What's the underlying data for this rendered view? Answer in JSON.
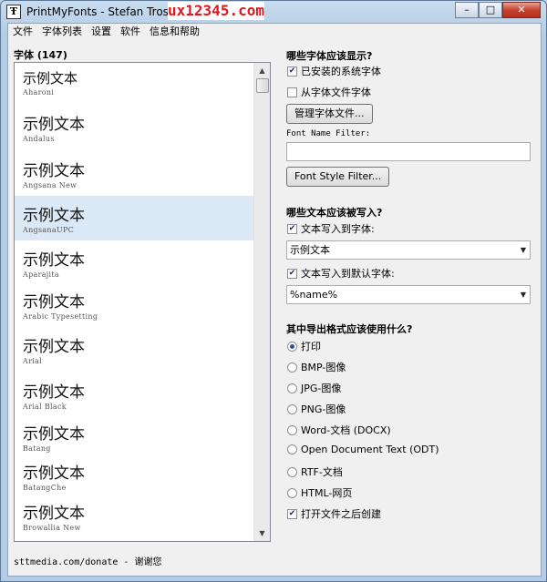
{
  "window": {
    "title": "PrintMyFonts - Stefan Trost Media",
    "watermark": "ux12345.com",
    "controls": {
      "minimize": "–",
      "maximize": "□",
      "close": "✕"
    }
  },
  "menu": [
    "文件",
    "字体列表",
    "设置",
    "软件",
    "信息和帮助"
  ],
  "font_list": {
    "heading": "字体 (147)",
    "items": [
      {
        "sample": "示例文本",
        "name": "Aharoni"
      },
      {
        "sample": "示例文本",
        "name": "Andalus"
      },
      {
        "sample": "示例文本",
        "name": "Angsana New"
      },
      {
        "sample": "示例文本",
        "name": "AngsanaUPC",
        "selected": true
      },
      {
        "sample": "示例文本",
        "name": "Aparajita"
      },
      {
        "sample": "示例文本",
        "name": "Arabic Typesetting"
      },
      {
        "sample": "示例文本",
        "name": "Arial"
      },
      {
        "sample": "示例文本",
        "name": "Arial Black"
      },
      {
        "sample": "示例文本",
        "name": "Batang"
      },
      {
        "sample": "示例文本",
        "name": "BatangChe"
      },
      {
        "sample": "示例文本",
        "name": "Browallia New"
      }
    ]
  },
  "display_section": {
    "heading": "哪些字体应该显示?",
    "installed_fonts": {
      "label": "已安装的系统字体",
      "checked": true
    },
    "from_files": {
      "label": "从字体文件字体",
      "checked": false
    },
    "manage_button": "管理字体文件...",
    "filter_label": "Font Name Filter:",
    "filter_value": "",
    "style_button": "Font Style Filter..."
  },
  "text_section": {
    "heading": "哪些文本应该被写入?",
    "write_text": {
      "label": "文本写入到字体:",
      "checked": true
    },
    "text_value": "示例文本",
    "write_default": {
      "label": "文本写入到默认字体:",
      "checked": true
    },
    "default_value": "%name%"
  },
  "export_section": {
    "heading": "其中导出格式应该使用什么?",
    "options": [
      {
        "label": "打印",
        "selected": true
      },
      {
        "label": "BMP-图像",
        "selected": false
      },
      {
        "label": "JPG-图像",
        "selected": false
      },
      {
        "label": "PNG-图像",
        "selected": false
      },
      {
        "label": "Word-文档 (DOCX)",
        "selected": false
      },
      {
        "label": "Open Document Text (ODT)",
        "selected": false
      },
      {
        "label": "RTF-文档",
        "selected": false
      },
      {
        "label": "HTML-网页",
        "selected": false
      }
    ],
    "open_after": {
      "label": "打开文件之后创建",
      "checked": true
    }
  },
  "footer": {
    "text": "sttmedia.com/donate - 谢谢您"
  }
}
